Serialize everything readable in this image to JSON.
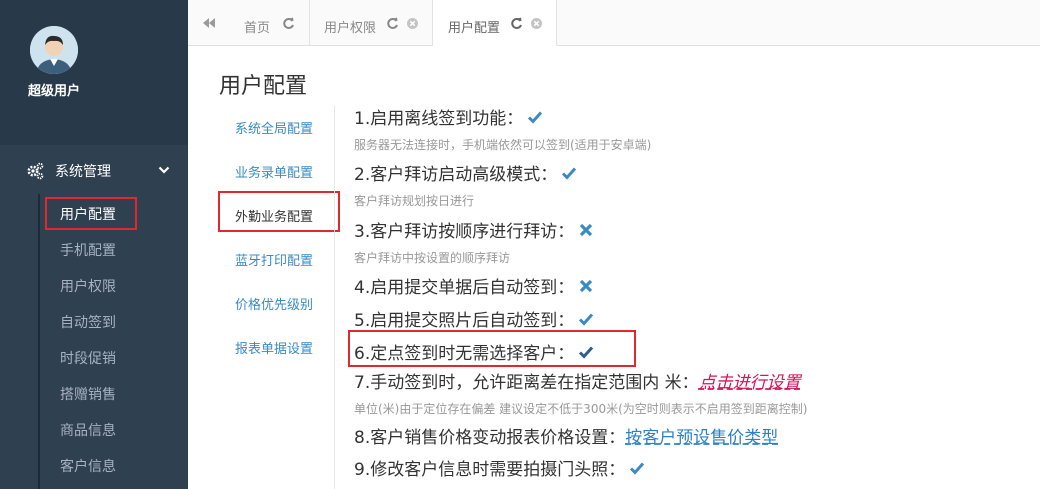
{
  "sidebar": {
    "username": "超级用户",
    "menu_title": "系统管理",
    "items": [
      {
        "label": "用户配置"
      },
      {
        "label": "手机配置"
      },
      {
        "label": "用户权限"
      },
      {
        "label": "自动签到"
      },
      {
        "label": "时段促销"
      },
      {
        "label": "搭赠销售"
      },
      {
        "label": "商品信息"
      },
      {
        "label": "客户信息"
      }
    ]
  },
  "tabs": [
    {
      "label": "首页"
    },
    {
      "label": "用户权限"
    },
    {
      "label": "用户配置"
    }
  ],
  "page": {
    "title": "用户配置",
    "left_nav": [
      {
        "label": "系统全局配置"
      },
      {
        "label": "业务录单配置"
      },
      {
        "label": "外勤业务配置"
      },
      {
        "label": "蓝牙打印配置"
      },
      {
        "label": "价格优先级别"
      },
      {
        "label": "报表单据设置"
      }
    ],
    "options": [
      {
        "label": "1.启用离线签到功能：",
        "state": "check",
        "desc": "服务器无法连接时，手机端依然可以签到(适用于安卓端)"
      },
      {
        "label": "2.客户拜访启动高级模式：",
        "state": "check",
        "desc": "客户拜访规划按日进行"
      },
      {
        "label": "3.客户拜访按顺序进行拜访：",
        "state": "cross",
        "desc": "客户拜访中按设置的顺序拜访"
      },
      {
        "label": "4.启用提交单据后自动签到：",
        "state": "cross",
        "desc": ""
      },
      {
        "label": "5.启用提交照片后自动签到：",
        "state": "check",
        "desc": ""
      },
      {
        "label": "6.定点签到时无需选择客户：",
        "state": "check-dark",
        "desc": ""
      },
      {
        "label": "7.手动签到时，允许距离差在指定范围内 米：",
        "link": "点击进行设置",
        "desc": "单位(米)由于定位存在偏差 建议设定不低于300米(为空时则表示不启用签到距离控制)"
      },
      {
        "label": "8.客户销售价格变动报表价格设置：",
        "link": "按客户预设售价类型",
        "desc": ""
      },
      {
        "label": "9.修改客户信息时需要拍摄门头照：",
        "state": "check",
        "desc": ""
      }
    ]
  },
  "colors": {
    "sidebar_bg": "#2f4050",
    "link_blue": "#3a8bc4",
    "check_blue": "#3a8bc4",
    "highlight_red": "#e2282f"
  }
}
